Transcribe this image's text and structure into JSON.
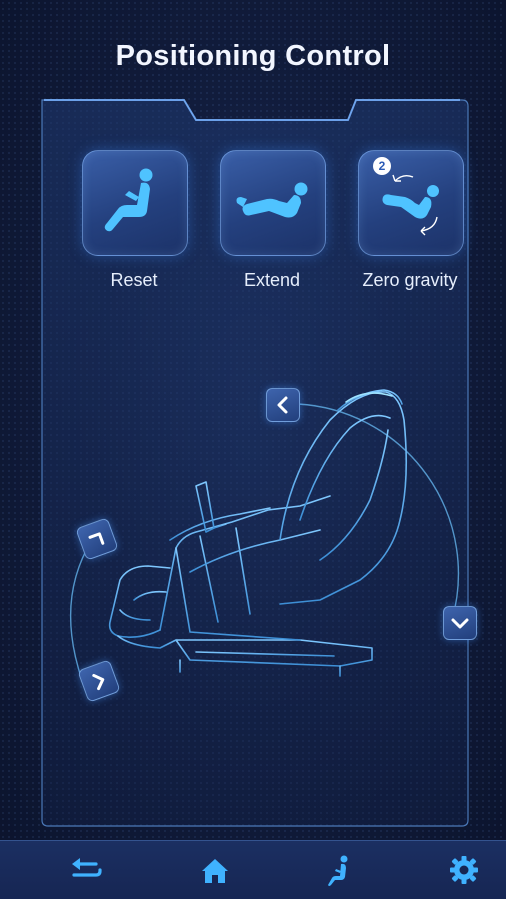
{
  "header": {
    "title": "Positioning Control"
  },
  "modes": [
    {
      "id": "reset",
      "label": "Reset",
      "icon": "recline-reset-icon"
    },
    {
      "id": "extend",
      "label": "Extend",
      "icon": "recline-extend-icon"
    },
    {
      "id": "zero_gravity",
      "label": "Zero gravity",
      "icon": "zero-gravity-icon",
      "badge": "2"
    }
  ],
  "chair_controls": {
    "backrest_up": "chevron-left-icon",
    "backrest_down": "chevron-down-icon",
    "legrest_up": "chevron-up-right-icon",
    "legrest_down": "chevron-right-icon"
  },
  "bottom_nav": [
    {
      "id": "back",
      "icon": "back-arrow-icon"
    },
    {
      "id": "home",
      "icon": "home-icon"
    },
    {
      "id": "chair",
      "icon": "seated-person-icon"
    },
    {
      "id": "settings",
      "icon": "gear-icon"
    }
  ],
  "colors": {
    "accent": "#3aa0ff",
    "button_fill": "#2a4a8f",
    "line": "#5fb6e8",
    "background": "#111c3c"
  }
}
